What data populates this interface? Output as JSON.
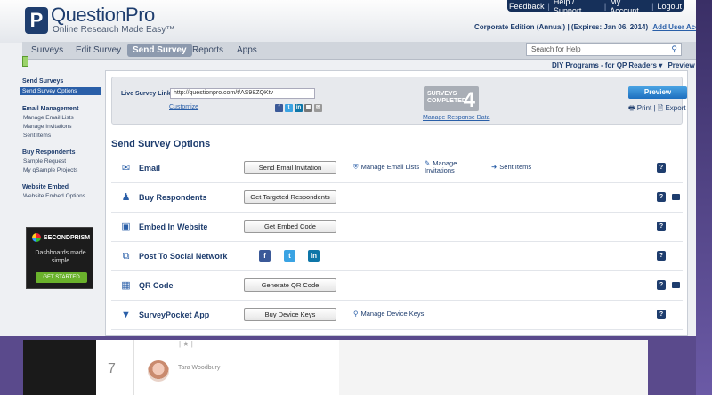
{
  "brand": {
    "logo_letter": "P",
    "name": "QuestionPro",
    "tagline": "Online Research Made Easy™"
  },
  "top_links": [
    "Feedback",
    "Help / Support",
    "My Account",
    "Logout"
  ],
  "edition": {
    "text": "Corporate Edition (Annual) | (Expires: Jan 06, 2014)",
    "add_users": "Add User Accounts"
  },
  "nav": {
    "items": [
      "Surveys",
      "Edit Survey",
      "Send Survey",
      "Reports",
      "Apps"
    ],
    "active": "Send Survey"
  },
  "search": {
    "placeholder": "Search for Help"
  },
  "diy": {
    "text": "DIY Programs - for QP Readers ▾",
    "preview": "Preview"
  },
  "sidebar": {
    "sections": [
      {
        "heading": "Send Surveys",
        "items": [
          "Send Survey Options"
        ]
      },
      {
        "heading": "Email Management",
        "items": [
          "Manage Email Lists",
          "Manage Invitations",
          "Sent Items"
        ]
      },
      {
        "heading": "Buy Respondents",
        "items": [
          "Sample Request",
          "My qSample Projects"
        ]
      },
      {
        "heading": "Website Embed",
        "items": [
          "Website Embed Options"
        ]
      }
    ],
    "selected": "Send Survey Options"
  },
  "ad": {
    "brand": "SECONDPRISM",
    "slogan": "Dashboards made simple",
    "cta": "GET STARTED"
  },
  "live": {
    "label": "Live Survey Link",
    "url": "http://questionpro.com/t/AS98ZQKtv",
    "customize": "Customize",
    "completed_label": "SURVEYS COMPLETED",
    "completed_count": "4",
    "manage_response": "Manage Response Data",
    "preview": "Preview",
    "print": "Print",
    "export": "Export"
  },
  "options": {
    "title": "Send Survey Options",
    "rows": [
      {
        "title": "Email",
        "button": "Send Email Invitation",
        "links": [
          "Manage Email Lists",
          "Manage Invitations",
          "Sent Items"
        ]
      },
      {
        "title": "Buy Respondents",
        "button": "Get Targeted Respondents",
        "links": []
      },
      {
        "title": "Embed In Website",
        "button": "Get Embed Code",
        "links": []
      },
      {
        "title": "Post To Social Network",
        "button": "",
        "links": []
      },
      {
        "title": "QR Code",
        "button": "Generate QR Code",
        "links": []
      },
      {
        "title": "SurveyPocket App",
        "button": "Buy Device Keys",
        "links": [
          "Manage Device Keys"
        ]
      }
    ],
    "help": "?"
  },
  "bottom": {
    "number": "7",
    "user": "Tara Woodbury",
    "meta": "| ★ |"
  },
  "colors": {
    "navy": "#1e3d6e",
    "link": "#2a5fa8",
    "frame_purple": "#5a4a8c"
  }
}
